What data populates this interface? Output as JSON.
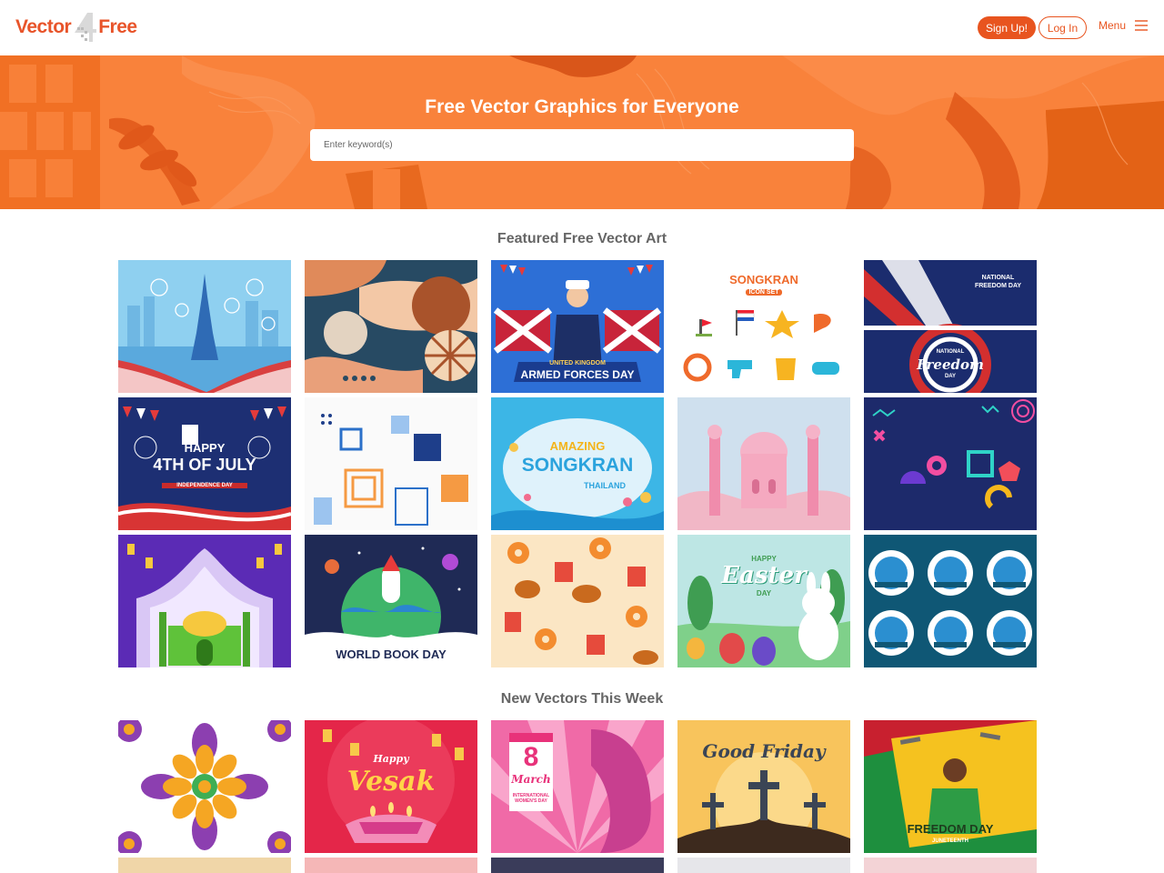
{
  "header": {
    "logo_left": "Vector",
    "logo_right": "Free",
    "signup_label": "Sign Up!",
    "login_label": "Log In",
    "menu_label": "Menu"
  },
  "hero": {
    "title": "Free Vector Graphics for Everyone",
    "search_placeholder": "Enter keyword(s)"
  },
  "featured": {
    "title": "Featured Free Vector Art",
    "tiles": [
      {
        "name": "paris-eiffel-tower"
      },
      {
        "name": "abstract-shapes"
      },
      {
        "name": "armed-forces-day",
        "line1": "UNITED KINGDOM",
        "line2": "ARMED FORCES DAY"
      },
      {
        "name": "songkran-icon-set",
        "line1": "SONGKRAN",
        "line2": "ICON SET"
      },
      {
        "name": "national-freedom-day",
        "line1": "NATIONAL",
        "line2": "FREEDOM DAY",
        "line3": "NATIONAL",
        "line4": "Freedom",
        "line5": "DAY"
      },
      {
        "name": "fourth-of-july",
        "line1": "HAPPY",
        "line2": "4TH OF JULY",
        "line3": "INDEPENDENCE DAY"
      },
      {
        "name": "geometric-pattern"
      },
      {
        "name": "amazing-songkran",
        "line1": "AMAZING",
        "line2": "SONGKRAN",
        "line3": "THAILAND"
      },
      {
        "name": "pink-mosque"
      },
      {
        "name": "memphis-shapes"
      },
      {
        "name": "ramadan-mosque"
      },
      {
        "name": "world-book-day",
        "line1": "WORLD BOOK DAY"
      },
      {
        "name": "fast-food-pattern"
      },
      {
        "name": "happy-easter",
        "line1": "HAPPY",
        "line2": "Easter",
        "line3": "DAY"
      },
      {
        "name": "world-water-day-badges"
      }
    ]
  },
  "new_this_week": {
    "title": "New Vectors This Week",
    "tiles": [
      {
        "name": "mandala"
      },
      {
        "name": "happy-vesak",
        "line1": "Happy",
        "line2": "Vesak"
      },
      {
        "name": "womens-day",
        "line1": "8",
        "line2": "March",
        "line3": "INTERNATIONAL WOMEN'S DAY"
      },
      {
        "name": "good-friday",
        "line1": "Good Friday"
      },
      {
        "name": "freedom-day",
        "line1": "FREEDOM DAY",
        "line2": "JUNETEENTH"
      }
    ]
  }
}
